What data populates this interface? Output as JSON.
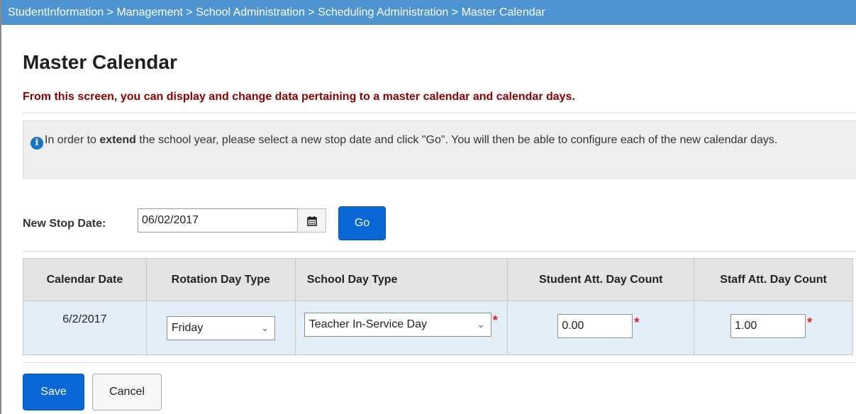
{
  "breadcrumb": {
    "items": [
      "StudentInformation",
      "Management",
      "School Administration",
      "Scheduling Administration",
      "Master Calendar"
    ],
    "separator": ">"
  },
  "page": {
    "title": "Master Calendar",
    "subtitle": "From this screen, you can display and change data pertaining to a master calendar and calendar days."
  },
  "info": {
    "icon": "info-icon",
    "text_before": "In order to ",
    "text_bold": "extend",
    "text_after": " the school year, please select a new stop date and click \"Go\". You will then be able to configure each of the new calendar days."
  },
  "stop_date": {
    "label": "New Stop Date:",
    "value": "06/02/2017",
    "calendar_icon": "calendar-icon",
    "go_label": "Go"
  },
  "table": {
    "headers": [
      "Calendar Date",
      "Rotation Day Type",
      "School Day Type",
      "Student Att. Day Count",
      "Staff Att. Day Count"
    ],
    "rows": [
      {
        "calendar_date": "6/2/2017",
        "rotation_day_type": "Friday",
        "school_day_type": "Teacher In-Service Day",
        "student_att_day_count": "0.00",
        "staff_att_day_count": "1.00"
      }
    ],
    "required_marker": "*"
  },
  "actions": {
    "save_label": "Save",
    "cancel_label": "Cancel"
  },
  "colors": {
    "breadcrumb_bg": "#4d94d1",
    "subtitle": "#8b0000",
    "primary_button": "#0a68d6",
    "row_bg": "#e3eef8",
    "header_bg": "#e4e4e4",
    "required": "#e02020"
  }
}
